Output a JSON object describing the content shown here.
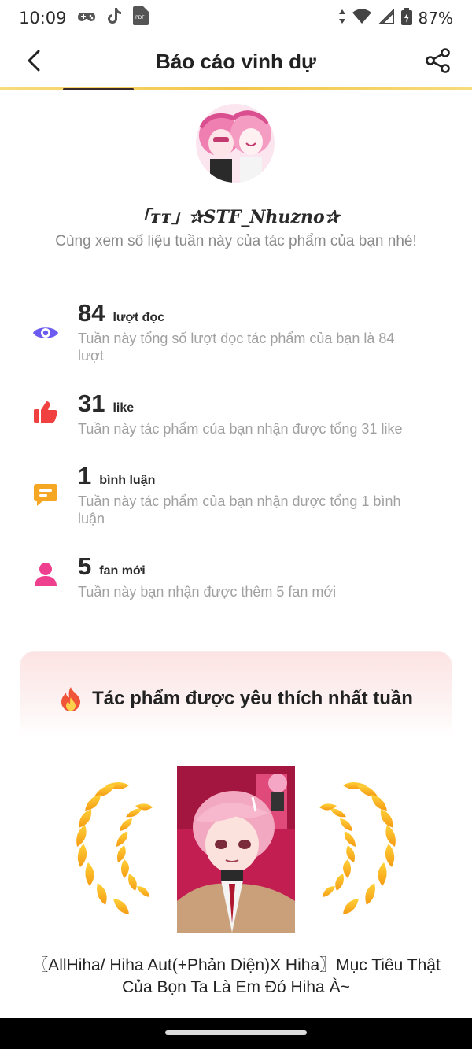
{
  "status_bar": {
    "time": "10:09",
    "battery": "87%"
  },
  "header": {
    "title": "Báo cáo vinh dự"
  },
  "profile": {
    "name": "「ᴛᴛ」✰STF_Nhuzno✰",
    "subtitle": "Cùng xem số liệu tuần này của tác phẩm của bạn nhé!"
  },
  "stats": [
    {
      "icon": "eye-icon",
      "value": "84",
      "unit": "lượt đọc",
      "desc": "Tuần này tổng số lượt đọc tác phẩm của bạn là 84 lượt",
      "color": "#6b5bf0"
    },
    {
      "icon": "thumbs-up-icon",
      "value": "31",
      "unit": "like",
      "desc": "Tuần này tác phẩm của bạn nhận được tổng 31 like",
      "color": "#f04040"
    },
    {
      "icon": "comment-icon",
      "value": "1",
      "unit": "bình luận",
      "desc": "Tuần này tác phẩm của bạn nhận được tổng 1 bình luận",
      "color": "#f5a623"
    },
    {
      "icon": "user-icon",
      "value": "5",
      "unit": "fan mới",
      "desc": "Tuần này bạn nhận được thêm 5 fan mới",
      "color": "#ef3f8f"
    }
  ],
  "top_work": {
    "heading": "Tác phẩm được yêu thích nhất tuần",
    "title": "〖AllHiha/ Hiha Aut(+Phản Diện)X Hiha〗Mục Tiêu Thật Của Bọn Ta Là Em Đó Hiha À~"
  }
}
